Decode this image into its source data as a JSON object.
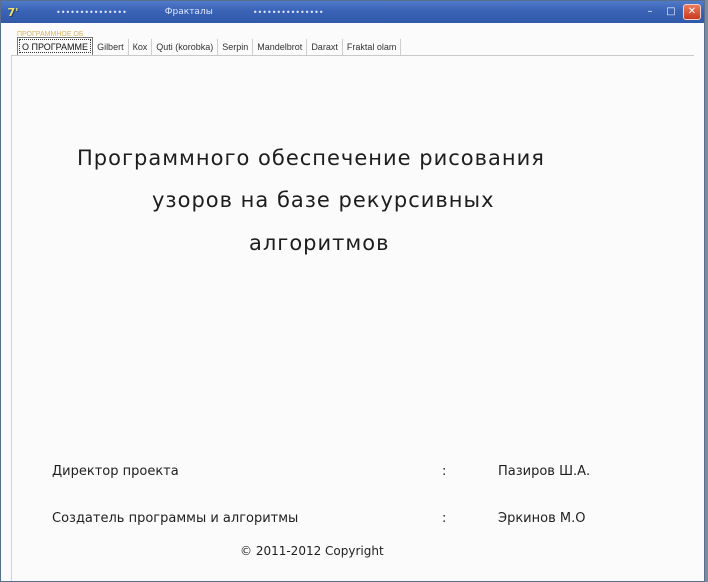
{
  "window": {
    "title_left_dots": "•••••••••••••••",
    "title": "Фракталы",
    "title_right_dots": "•••••••••••••••",
    "app_icon": "7'",
    "controls": {
      "minimize": "–",
      "maximize": "□",
      "close": "✕"
    },
    "colors": {
      "titlebar": "#3a63b6",
      "close_button": "#c9391f"
    }
  },
  "tabs": {
    "overlay_label": "ПРОГРАММНОЕ ОБ",
    "items": [
      {
        "label": "О ПРОГРАММЕ",
        "active": true
      },
      {
        "label": "Gilbert",
        "active": false
      },
      {
        "label": "Кох",
        "active": false
      },
      {
        "label": "Quti (korobka)",
        "active": false
      },
      {
        "label": "Serpin",
        "active": false
      },
      {
        "label": "Mandelbrot",
        "active": false
      },
      {
        "label": "Daraxt",
        "active": false
      },
      {
        "label": "Fraktal olam",
        "active": false
      }
    ]
  },
  "about": {
    "heading_line1": "Программного обеспечение рисования",
    "heading_line2": "узоров на базе рекурсивных",
    "heading_line3": "алгоритмов",
    "director_label": "Директор проекта",
    "director_sep": ":",
    "director_name": "Пазиров Ш.А.",
    "creator_label": "Создатель программы и алгоритмы",
    "creator_sep": ":",
    "creator_name": "Эркинов М.О",
    "copyright": "© 2011-2012   Copyright"
  }
}
